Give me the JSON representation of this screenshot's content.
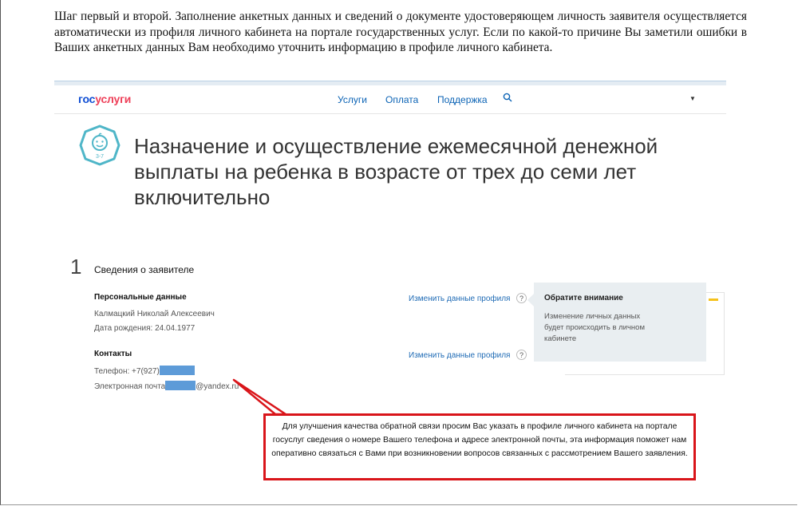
{
  "instruction_text": "Шаг первый и второй. Заполнение анкетных данных и сведений о документе удостоверяющем личность заявителя осуществляется автоматически из профиля личного кабинета на портале государственных услуг. Если по какой-то причине Вы заметили ошибки в Ваших анкетных данных Вам необходимо уточнить информацию в профиле личного кабинета.",
  "header": {
    "logo_part1": "гос",
    "logo_part2": "услуги",
    "nav": [
      "Услуги",
      "Оплата",
      "Поддержка"
    ]
  },
  "service": {
    "badge_text": "3-7",
    "title": "Назначение и осуществление ежемесячной денежной выплаты на ребенка в возрасте от трех до семи лет включительно"
  },
  "step": {
    "number": "1",
    "title": "Сведения о заявителе"
  },
  "personal": {
    "heading": "Персональные данные",
    "name": "Калмацкий Николай Алексеевич",
    "birth_date": "Дата рождения: 24.04.1977",
    "edit_link": "Изменить данные профиля"
  },
  "contacts": {
    "heading": "Контакты",
    "phone_prefix": "Телефон: +7(927)",
    "email_prefix": "Электронная почта",
    "email_suffix": "@yandex.ru",
    "edit_link": "Изменить данные профиля"
  },
  "tooltip": {
    "title": "Обратите внимание",
    "body": "Изменение личных данных будет происходить в личном кабинете"
  },
  "help_glyph": "?",
  "callout": {
    "text": "Для улучшения качества обратной связи просим Вас указать в профиле личного кабинета на портале госуслуг сведения о номере Вашего телефона и адресе электронной почты, эта информация поможет нам оперативно связаться с Вами при возникновении вопросов связанных с рассмотрением Вашего заявления."
  },
  "colors": {
    "brand_blue": "#0d4cd3",
    "brand_red": "#ee3f58",
    "link_blue": "#1f6bb5",
    "callout_red": "#d9151a",
    "redaction_blue": "#5d9bd8",
    "accent_yellow": "#f6c21b"
  }
}
